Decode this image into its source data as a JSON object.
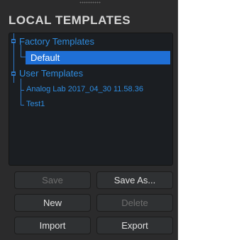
{
  "panel": {
    "title": "LOCAL TEMPLATES",
    "tree": {
      "factory_label": "Factory Templates",
      "factory_children": [
        "Default"
      ],
      "user_label": "User Templates",
      "user_children": [
        "Analog Lab 2017_04_30 11.58.36",
        "Test1"
      ],
      "selected": "Default"
    },
    "buttons": {
      "save": "Save",
      "save_as": "Save As...",
      "new": "New",
      "delete": "Delete",
      "import": "Import",
      "export": "Export"
    },
    "colors": {
      "accent": "#2e8ce0",
      "selection": "#1f6fd6",
      "panel_bg": "#2b2b2c",
      "tree_bg": "#1b1e22"
    }
  }
}
